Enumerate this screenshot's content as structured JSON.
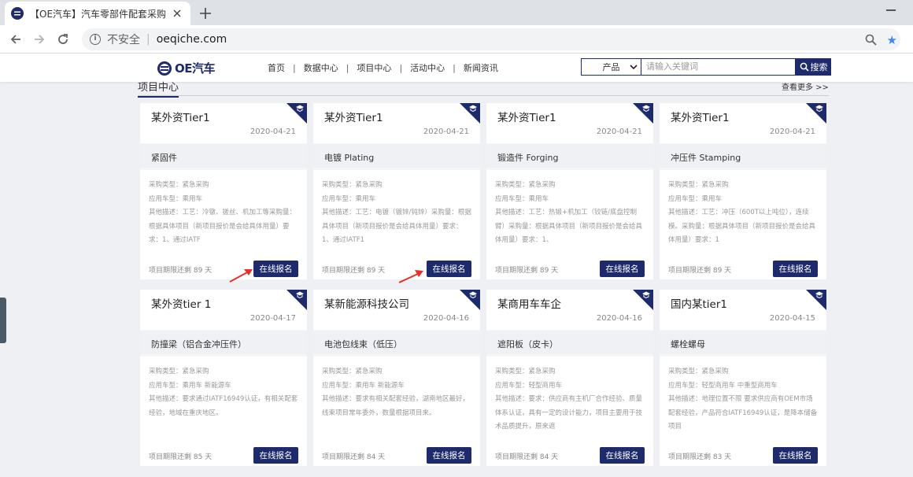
{
  "browser": {
    "tab_title": "【OE汽车】汽车零部件配套采购",
    "security_label": "不安全",
    "url": "oeqiche.com"
  },
  "site": {
    "logo_text": "OE汽车",
    "nav": [
      "首页",
      "数据中心",
      "项目中心",
      "活动中心",
      "新闻资讯"
    ],
    "search": {
      "category": "产品",
      "placeholder": "请输入关键词",
      "button": "搜索"
    }
  },
  "section": {
    "title": "项目中心",
    "more": "查看更多 >>"
  },
  "cards": [
    {
      "buyer": "某外资Tier1",
      "date": "2020-04-21",
      "part": "紧固件",
      "purchase_type": "采购类型：紧急采购",
      "vehicle_type": "应用车型：乘用车",
      "description": "其他描述：工艺：冷镦、搓丝、机加工等采购量：根据具体项目（新项目报价是会给具体用量）要求：1、通过IATF",
      "deadline": "项目期限还剩 89 天",
      "button": "在线报名"
    },
    {
      "buyer": "某外资Tier1",
      "date": "2020-04-21",
      "part": "电镀 Plating",
      "purchase_type": "采购类型：紧急采购",
      "vehicle_type": "应用车型：乘用车",
      "description": "其他描述：工艺：电镀（镀锌/钝锌）采购量：根据具体项目（新项目报价是会给具体用量）要求：1、通过IATF1",
      "deadline": "项目期限还剩 89 天",
      "button": "在线报名"
    },
    {
      "buyer": "某外资Tier1",
      "date": "2020-04-21",
      "part": "锻造件 Forging",
      "purchase_type": "采购类型：紧急采购",
      "vehicle_type": "应用车型：乘用车",
      "description": "其他描述：工艺：热锻+机加工（铰链/底盘控制臂）采购量：根据具体项目（新项目报价是会给具体用量）要求：1、",
      "deadline": "项目期限还剩 89 天",
      "button": "在线报名"
    },
    {
      "buyer": "某外资Tier1",
      "date": "2020-04-21",
      "part": "冲压件 Stamping",
      "purchase_type": "采购类型：紧急采购",
      "vehicle_type": "应用车型：乘用车",
      "description": "其他描述：工艺：冲压（600T以上吨位），连续模。采购量：根据具体项目（新项目报价是会给具体用量）要求：1",
      "deadline": "项目期限还剩 89 天",
      "button": "在线报名"
    },
    {
      "buyer": "某外资tier 1",
      "date": "2020-04-17",
      "part": "防撞梁（铝合金冲压件）",
      "purchase_type": "采购类型：紧急采购",
      "vehicle_type": "应用车型：乘用车 新能源车",
      "description": "其他描述：要求通过IATF16949认证，有相关配套经验，地域在重庆地区。",
      "deadline": "项目期限还剩 85 天",
      "button": "在线报名"
    },
    {
      "buyer": "某新能源科技公司",
      "date": "2020-04-16",
      "part": "电池包线束（低压）",
      "purchase_type": "采购类型：紧急采购",
      "vehicle_type": "应用车型：乘用车 新能源车",
      "description": "其他描述：要求有相关配套经验，湖南地区最好，线束项目常年委外，数量根据项目来。",
      "deadline": "项目期限还剩 84 天",
      "button": "在线报名"
    },
    {
      "buyer": "某商用车车企",
      "date": "2020-04-16",
      "part": "遮阳板（皮卡）",
      "purchase_type": "采购类型：紧急采购",
      "vehicle_type": "应用车型：轻型商用车",
      "description": "其他描述：要求：供应商有主机厂合作经验、质量体系认证，具有一定的设计能力，项目主要用于技术品质提升，原来遮",
      "deadline": "项目期限还剩 84 天",
      "button": "在线报名"
    },
    {
      "buyer": "国内某tier1",
      "date": "2020-04-15",
      "part": "螺栓螺母",
      "purchase_type": "采购类型：紧急采购",
      "vehicle_type": "应用车型：轻型商用车 中重型商用车",
      "description": "其他描述：地理位置不限 要求供应商有OEM市场配套经验，产品符合IATF16949认证，是降本储备项目",
      "deadline": "项目期限还剩 83 天",
      "button": "在线报名"
    }
  ],
  "colors": {
    "brand": "#1d2a6b",
    "arrow": "#e8302a"
  }
}
